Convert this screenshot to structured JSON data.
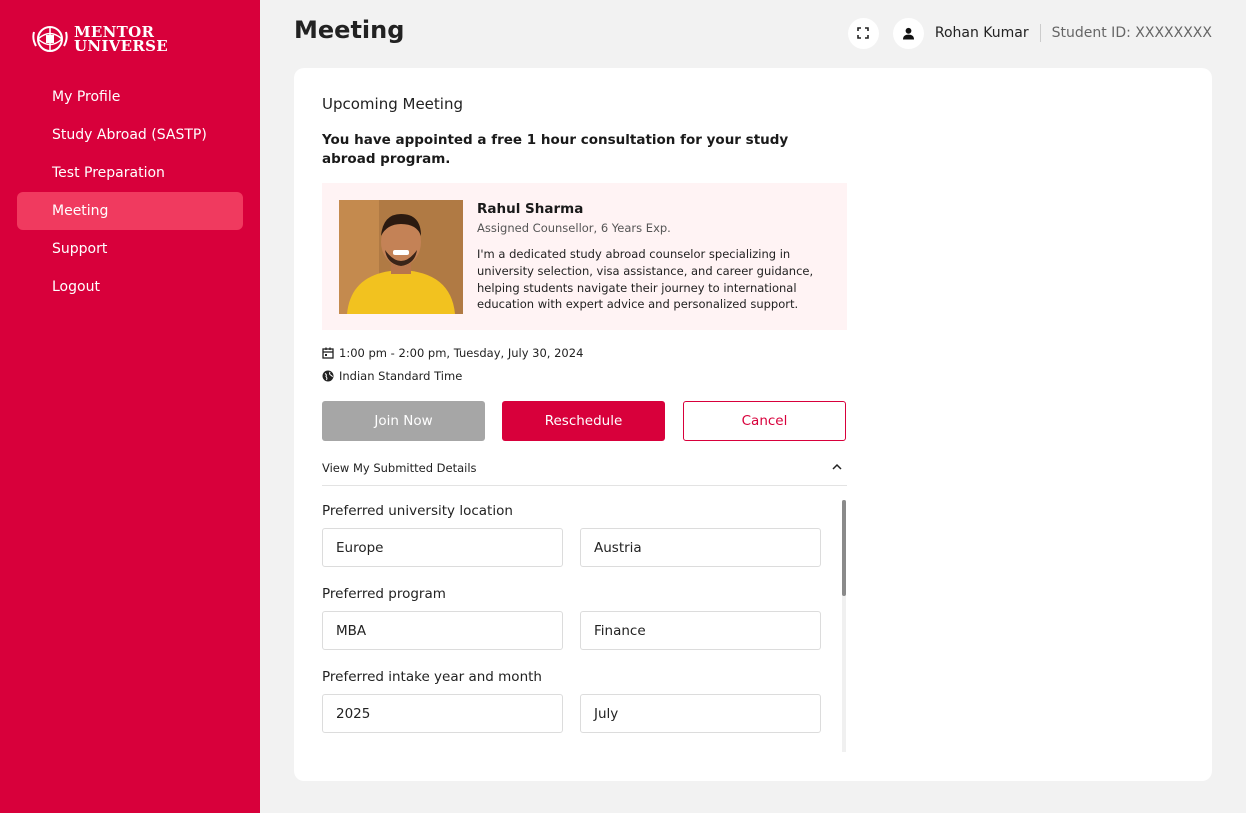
{
  "brand": {
    "line1": "MENTOR",
    "line2": "UNIVERSE"
  },
  "sidebar": {
    "items": [
      {
        "label": "My Profile"
      },
      {
        "label": "Study Abroad (SASTP)"
      },
      {
        "label": "Test Preparation"
      },
      {
        "label": "Meeting",
        "active": true
      },
      {
        "label": "Support"
      },
      {
        "label": "Logout"
      }
    ]
  },
  "header": {
    "title": "Meeting",
    "user_name": "Rohan Kumar",
    "student_id": "Student ID: XXXXXXXX"
  },
  "meeting": {
    "section_title": "Upcoming Meeting",
    "description": "You have appointed a free 1 hour consultation for your study abroad program.",
    "counsellor": {
      "name": "Rahul Sharma",
      "role": "Assigned Counsellor, 6 Years Exp.",
      "bio": "I'm a dedicated study abroad counselor specializing in university selection, visa assistance, and career guidance, helping students navigate their journey to international education with expert advice and personalized support."
    },
    "time": "1:00 pm - 2:00 pm, Tuesday, July 30, 2024",
    "timezone": "Indian Standard Time",
    "buttons": {
      "join": "Join Now",
      "reschedule": "Reschedule",
      "cancel": "Cancel"
    }
  },
  "details": {
    "toggle_label": "View My Submitted Details",
    "fields": [
      {
        "label": "Preferred university location",
        "values": [
          "Europe",
          "Austria"
        ]
      },
      {
        "label": "Preferred program",
        "values": [
          "MBA",
          "Finance"
        ]
      },
      {
        "label": "Preferred intake year and month",
        "values": [
          "2025",
          "July"
        ]
      }
    ]
  },
  "colors": {
    "brand": "#d8003b",
    "active_nav": "#f03a5f",
    "disabled": "#a6a6a6",
    "card_tint": "#fff3f4"
  },
  "icons": [
    "mentor-universe-logo",
    "fullscreen-icon",
    "user-icon",
    "calendar-icon",
    "globe-icon",
    "chevron-up-icon"
  ]
}
